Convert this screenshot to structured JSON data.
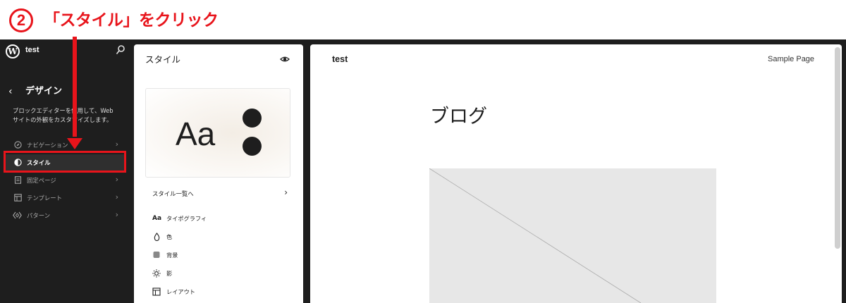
{
  "annotation": {
    "step_number": "2",
    "instruction": "「スタイル」をクリック",
    "accent_color": "#e8141b"
  },
  "sidebar": {
    "site_name": "test",
    "title": "デザイン",
    "description": "ブロックエディターを使用して、Webサイトの外観をカスタマイズします。",
    "items": [
      {
        "label": "ナビゲーション",
        "icon": "navigation-icon",
        "active": false
      },
      {
        "label": "スタイル",
        "icon": "styles-icon",
        "active": true
      },
      {
        "label": "固定ページ",
        "icon": "page-icon",
        "active": false
      },
      {
        "label": "テンプレート",
        "icon": "template-icon",
        "active": false
      },
      {
        "label": "パターン",
        "icon": "pattern-icon",
        "active": false
      }
    ]
  },
  "styles_panel": {
    "title": "スタイル",
    "preview_text": "Aa",
    "browse_label": "スタイル一覧へ",
    "items": [
      {
        "label": "タイポグラフィ",
        "icon": "typography-icon",
        "glyph": "Aa"
      },
      {
        "label": "色",
        "icon": "color-drop-icon"
      },
      {
        "label": "背景",
        "icon": "background-icon"
      },
      {
        "label": "影",
        "icon": "shadow-icon"
      },
      {
        "label": "レイアウト",
        "icon": "layout-icon"
      }
    ]
  },
  "canvas": {
    "site_title": "test",
    "nav_link": "Sample Page",
    "page_title": "ブログ"
  }
}
